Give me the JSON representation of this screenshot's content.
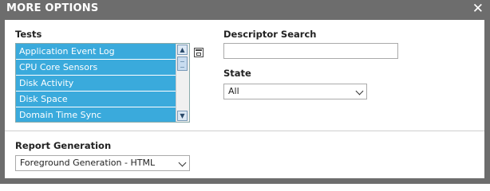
{
  "dialog": {
    "title": "MORE OPTIONS",
    "close_glyph": "✕"
  },
  "tests": {
    "label": "Tests",
    "items": [
      "Application Event Log",
      "CPU Core Sensors",
      "Disk Activity",
      "Disk Space",
      "Domain Time Sync"
    ],
    "scroll_up_glyph": "▲",
    "scroll_down_glyph": "▼"
  },
  "descriptor_search": {
    "label": "Descriptor Search",
    "value": ""
  },
  "state": {
    "label": "State",
    "selected": "All"
  },
  "report_generation": {
    "label": "Report Generation",
    "selected": "Foreground Generation - HTML"
  },
  "colors": {
    "titlebar": "#6d6d6d",
    "list_selected_bg": "#3aaadc",
    "list_text": "#ffffff"
  },
  "icons": {
    "close": "close-icon",
    "select_all": "select-all-icon",
    "dropdown": "chevron-down-icon"
  }
}
